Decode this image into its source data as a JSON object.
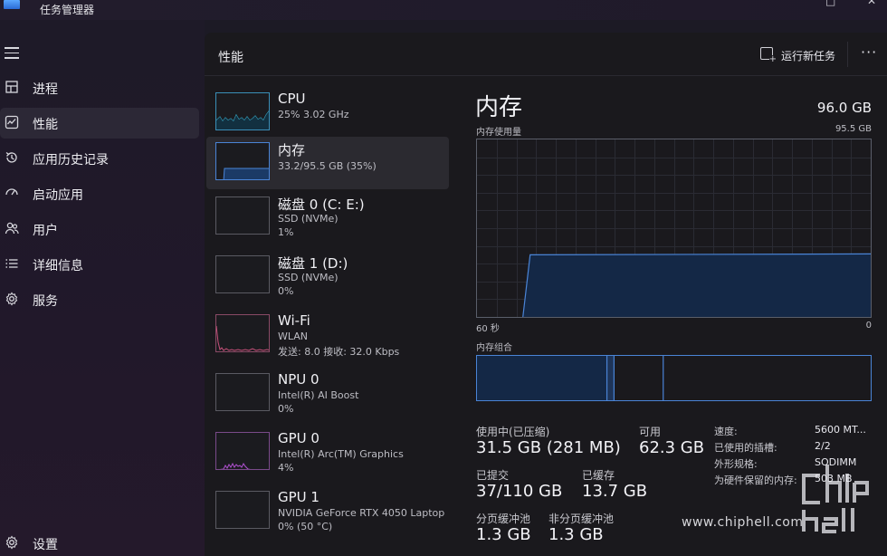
{
  "app": {
    "title": "任务管理器"
  },
  "window_controls": {
    "maximize": "□",
    "close": "✕"
  },
  "nav": {
    "items": [
      {
        "label": "进程",
        "icon": "processes-icon"
      },
      {
        "label": "性能",
        "icon": "performance-icon",
        "active": true
      },
      {
        "label": "应用历史记录",
        "icon": "history-icon"
      },
      {
        "label": "启动应用",
        "icon": "startup-icon"
      },
      {
        "label": "用户",
        "icon": "users-icon"
      },
      {
        "label": "详细信息",
        "icon": "details-icon"
      },
      {
        "label": "服务",
        "icon": "services-icon"
      }
    ],
    "settings_label": "设置"
  },
  "header": {
    "title": "性能",
    "run_task_label": "运行新任务",
    "more": "···"
  },
  "devices": [
    {
      "name": "CPU",
      "sub1": "25%  3.02 GHz",
      "sub2": "",
      "sub3": "",
      "color": "#3aa0c8"
    },
    {
      "name": "内存",
      "sub1": "33.2/95.5 GB (35%)",
      "sub2": "",
      "sub3": "",
      "color": "#4a84d6",
      "selected": true
    },
    {
      "name": "磁盘 0 (C: E:)",
      "sub1": "SSD (NVMe)",
      "sub2": "1%",
      "sub3": "",
      "color": "#6aa84f"
    },
    {
      "name": "磁盘 1 (D:)",
      "sub1": "SSD (NVMe)",
      "sub2": "0%",
      "sub3": "",
      "color": "#6aa84f"
    },
    {
      "name": "Wi-Fi",
      "sub1": "WLAN",
      "sub2": "发送: 8.0  接收: 32.0 Kbps",
      "sub3": "",
      "color": "#c8507a"
    },
    {
      "name": "NPU 0",
      "sub1": "Intel(R) AI Boost",
      "sub2": "0%",
      "sub3": "",
      "color": "#8a70c8"
    },
    {
      "name": "GPU 0",
      "sub1": "Intel(R) Arc(TM) Graphics",
      "sub2": "4%",
      "sub3": "",
      "color": "#a050c0"
    },
    {
      "name": "GPU 1",
      "sub1": "NVIDIA GeForce RTX 4050 Laptop",
      "sub2": "0%  (50 °C)",
      "sub3": "",
      "color": "#a050c0"
    }
  ],
  "memory": {
    "title": "内存",
    "total": "96.0 GB",
    "usage_label": "内存使用量",
    "usage_max": "95.5 GB",
    "time_left": "60 秒",
    "time_right": "0",
    "composition_label": "内存组合",
    "stats": {
      "in_use_label": "使用中(已压缩)",
      "in_use_value": "31.5 GB (281 MB)",
      "available_label": "可用",
      "available_value": "62.3 GB",
      "committed_label": "已提交",
      "committed_value": "37/110 GB",
      "cached_label": "已缓存",
      "cached_value": "13.7 GB",
      "paged_label": "分页缓冲池",
      "paged_value": "1.3 GB",
      "nonpaged_label": "非分页缓冲池",
      "nonpaged_value": "1.3 GB"
    },
    "props": [
      {
        "label": "速度:",
        "value": "5600 MT..."
      },
      {
        "label": "已使用的插槽:",
        "value": "2/2"
      },
      {
        "label": "外形规格:",
        "value": "SODIMM"
      },
      {
        "label": "为硬件保留的内存:",
        "value": "503 MB"
      }
    ],
    "usage_fraction": 0.35,
    "composition": {
      "in_use_fraction": 0.33,
      "modified_fraction": 0.018,
      "standby_fraction": 0.125
    }
  },
  "watermark": {
    "text": "www.chiphell.com",
    "logo_text": "chip hell"
  }
}
